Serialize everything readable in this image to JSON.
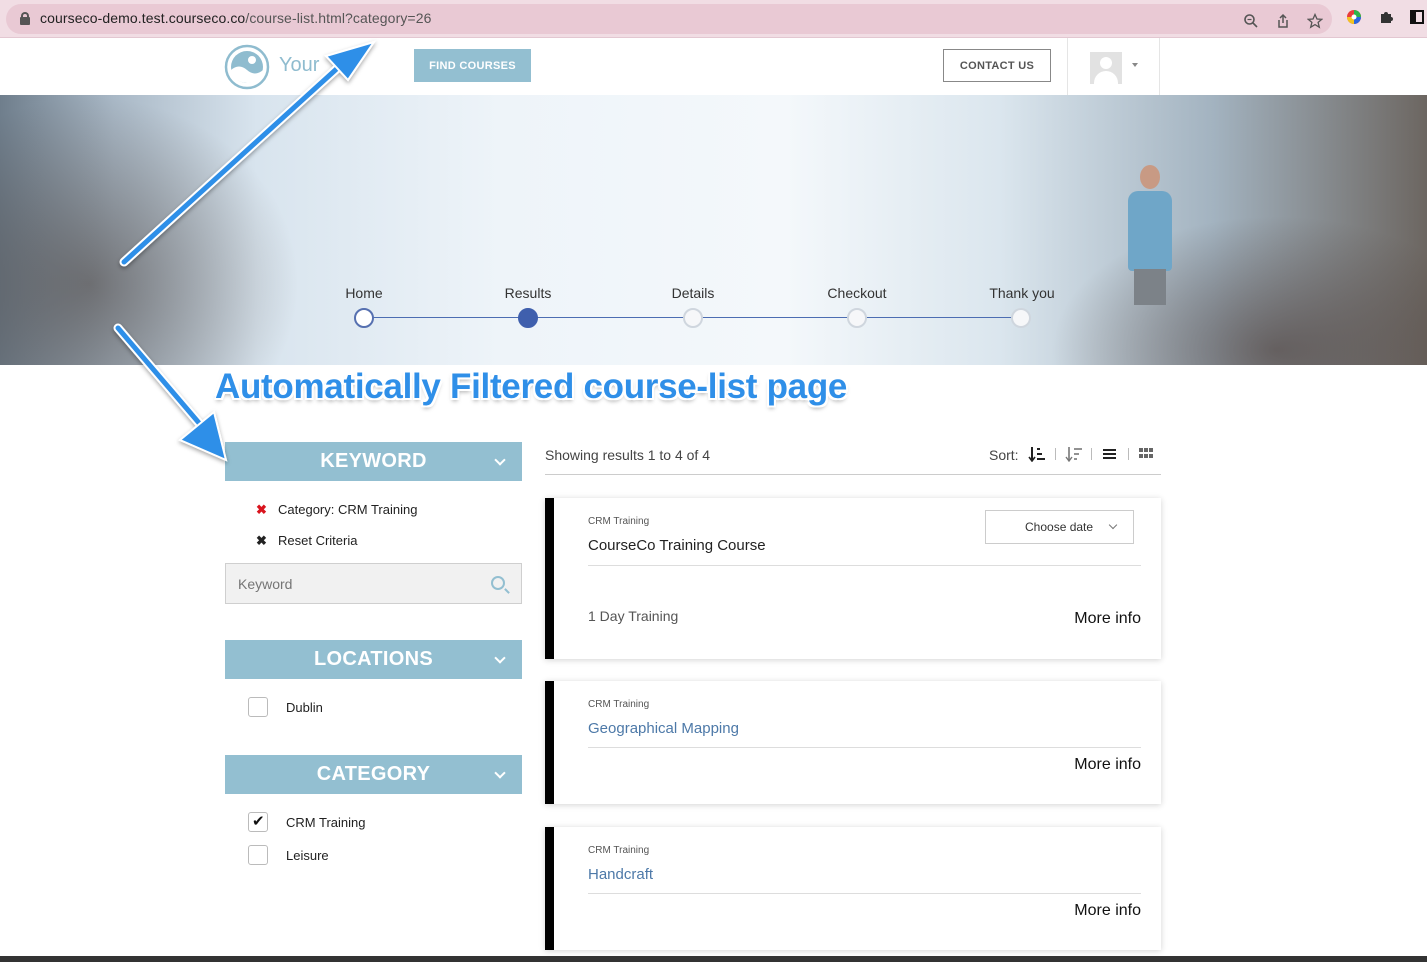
{
  "browser": {
    "url_host": "courseco-demo.test.courseco.co",
    "url_path": "/course-list.html?category=26",
    "icons": [
      "zoom-icon",
      "share-icon",
      "star-icon",
      "color-extension-icon",
      "puzzle-icon",
      "sidebar-icon"
    ]
  },
  "header": {
    "logo_text": "Your",
    "find_courses": "FIND COURSES",
    "contact_us": "CONTACT US"
  },
  "steps": [
    {
      "label": "Home",
      "state": "done"
    },
    {
      "label": "Results",
      "state": "active"
    },
    {
      "label": "Details",
      "state": "pending"
    },
    {
      "label": "Checkout",
      "state": "pending"
    },
    {
      "label": "Thank you",
      "state": "pending"
    }
  ],
  "annotation": {
    "text": "Automatically Filtered course-list page",
    "color": "#2f8fe8"
  },
  "sidebar": {
    "keyword_header": "KEYWORD",
    "criteria": [
      {
        "label": "Category: CRM Training",
        "icon": "remove-red-icon"
      },
      {
        "label": "Reset Criteria",
        "icon": "remove-black-icon"
      }
    ],
    "keyword_placeholder": "Keyword",
    "locations_header": "LOCATIONS",
    "locations": [
      {
        "label": "Dublin",
        "checked": false
      }
    ],
    "category_header": "CATEGORY",
    "categories": [
      {
        "label": "CRM Training",
        "checked": true
      },
      {
        "label": "Leisure",
        "checked": false
      }
    ]
  },
  "results": {
    "summary": "Showing results 1 to 4 of 4",
    "sort_label": "Sort:",
    "courses": [
      {
        "category": "CRM Training",
        "title": "CourseCo Training Course",
        "meta": "1 Day Training",
        "date_select": "Choose date",
        "more": "More info"
      },
      {
        "category": "CRM Training",
        "title": "Geographical Mapping",
        "more": "More info"
      },
      {
        "category": "CRM Training",
        "title": "Handcraft",
        "more": "More info"
      }
    ]
  },
  "colors": {
    "accent": "#93bfd1",
    "step_active": "#3f5fad",
    "link": "#4d79a8",
    "remove_red": "#d9141e"
  }
}
